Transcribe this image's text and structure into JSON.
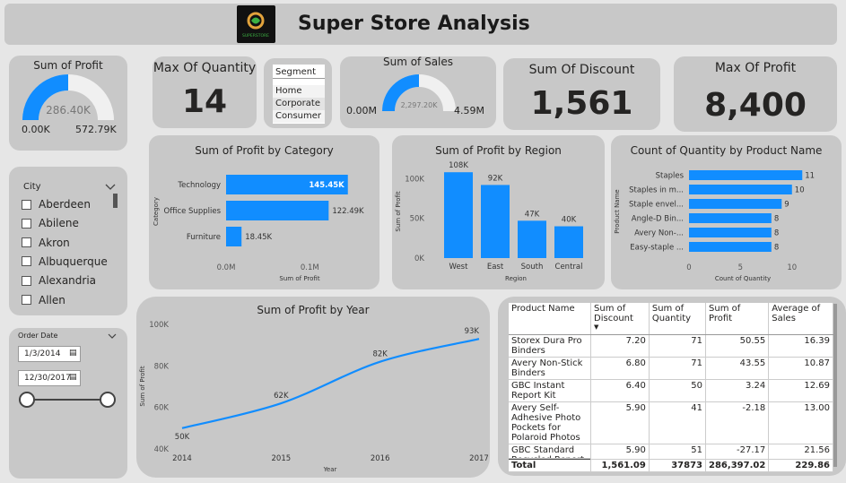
{
  "header": {
    "title": "Super Store Analysis",
    "logo_text": "SUPERSTORE",
    "logo_color": "#2a7a2a"
  },
  "colors": {
    "accent": "#118DFF",
    "card": "#c8c8c8",
    "gauge_bg": "#f0f0f0"
  },
  "profit_gauge": {
    "title": "Sum of Profit",
    "value": "286.40K",
    "min": "0.00K",
    "max": "572.79K",
    "fraction": 0.5
  },
  "max_quantity": {
    "title": "Max Of Quantity",
    "value": "14"
  },
  "segment": {
    "title": "Segment",
    "items": [
      "Home Office",
      "Corporate",
      "Consumer"
    ]
  },
  "sales_gauge": {
    "title": "Sum of Sales",
    "value": "2,297.20K",
    "min": "0.00M",
    "max": "4.59M",
    "fraction": 0.5
  },
  "discount": {
    "title": "Sum Of Discount",
    "value": "1,561"
  },
  "max_profit": {
    "title": "Max Of Profit",
    "value": "8,400"
  },
  "city": {
    "title": "City",
    "items": [
      "Aberdeen",
      "Abilene",
      "Akron",
      "Albuquerque",
      "Alexandria",
      "Allen"
    ]
  },
  "order_date": {
    "title": "Order Date",
    "start": "1/3/2014",
    "end": "12/30/2017"
  },
  "table": {
    "headers": [
      "Product Name",
      "Sum of Discount",
      "Sum of Quantity",
      "Sum of Profit",
      "Average of Sales"
    ],
    "rows": [
      [
        "Storex Dura Pro Binders",
        "7.20",
        "71",
        "50.55",
        "16.39"
      ],
      [
        "Avery Non-Stick Binders",
        "6.80",
        "71",
        "43.55",
        "10.87"
      ],
      [
        "GBC Instant Report Kit",
        "6.40",
        "50",
        "3.24",
        "12.69"
      ],
      [
        "Avery Self-Adhesive Photo Pockets for Polaroid Photos",
        "5.90",
        "41",
        "-2.18",
        "13.00"
      ],
      [
        "GBC Standard Recycled Report Covers",
        "5.90",
        "51",
        "-27.17",
        "21.56"
      ]
    ],
    "total": [
      "Total",
      "1,561.09",
      "37873",
      "286,397.02",
      "229.86"
    ]
  },
  "chart_data": [
    {
      "type": "bar",
      "orientation": "horizontal",
      "title": "Sum of Profit by Category",
      "xlabel": "Sum of Profit",
      "ylabel": "Category",
      "categories": [
        "Technology",
        "Office Supplies",
        "Furniture"
      ],
      "values": [
        145450,
        122490,
        18450
      ],
      "data_labels": [
        "145.45K",
        "122.49K",
        "18.45K"
      ],
      "xlim": [
        0,
        150000
      ],
      "x_ticks": [
        0,
        100000
      ],
      "x_tick_labels": [
        "0.0M",
        "0.1M"
      ]
    },
    {
      "type": "bar",
      "title": "Sum of Profit by Region",
      "xlabel": "Region",
      "ylabel": "Sum of Profit",
      "categories": [
        "West",
        "East",
        "South",
        "Central"
      ],
      "values": [
        108000,
        92000,
        47000,
        40000
      ],
      "data_labels": [
        "108K",
        "92K",
        "47K",
        "40K"
      ],
      "ylim": [
        0,
        115000
      ],
      "y_ticks": [
        0,
        50000,
        100000
      ],
      "y_tick_labels": [
        "0K",
        "50K",
        "100K"
      ]
    },
    {
      "type": "bar",
      "orientation": "horizontal",
      "title": "Count of Quantity by Product Name",
      "xlabel": "Count of Quantity",
      "ylabel": "Product Name",
      "categories": [
        "Staples",
        "Staples in m...",
        "Staple envel...",
        "Angle-D Bin...",
        "Avery Non-...",
        "Easy-staple ..."
      ],
      "values": [
        11,
        10,
        9,
        8,
        8,
        8
      ],
      "xlim": [
        0,
        11.5
      ],
      "x_ticks": [
        0,
        5,
        10
      ],
      "x_tick_labels": [
        "0",
        "5",
        "10"
      ]
    },
    {
      "type": "line",
      "title": "Sum of Profit by Year",
      "xlabel": "Year",
      "ylabel": "Sum of Profit",
      "x": [
        2014,
        2015,
        2016,
        2017
      ],
      "values": [
        50000,
        62000,
        82000,
        93000
      ],
      "data_labels": [
        "50K",
        "62K",
        "82K",
        "93K"
      ],
      "ylim": [
        40000,
        100000
      ],
      "y_ticks": [
        40000,
        60000,
        80000,
        100000
      ],
      "y_tick_labels": [
        "40K",
        "60K",
        "80K",
        "100K"
      ]
    }
  ]
}
